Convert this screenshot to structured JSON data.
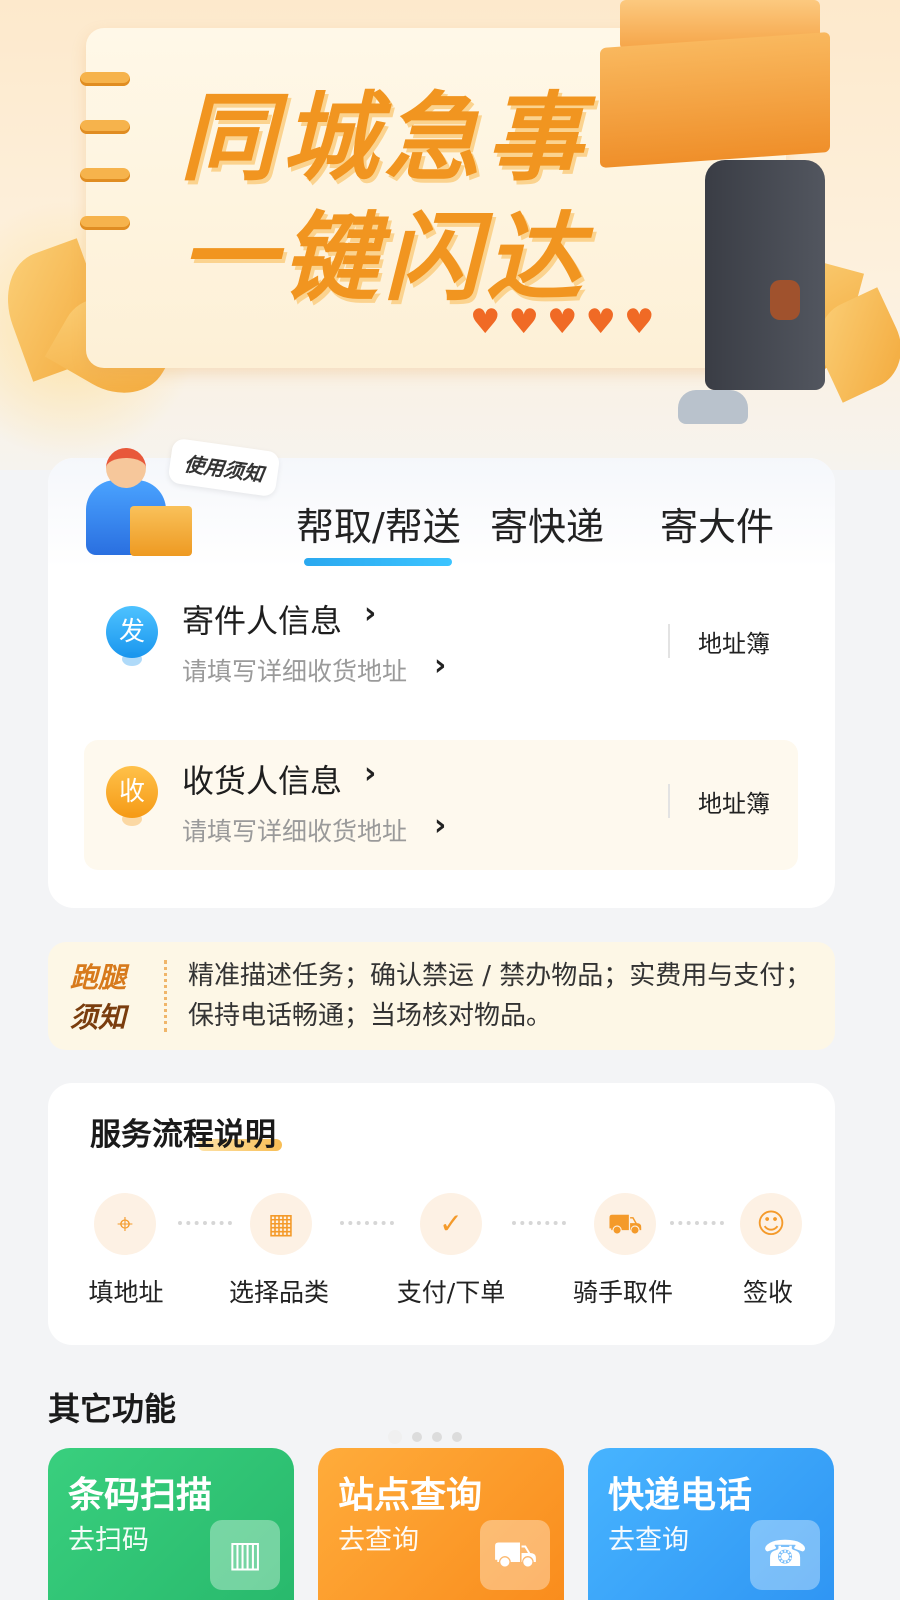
{
  "banner": {
    "headline_line1": "同城急事",
    "headline_line2": "一键闪达",
    "hearts": "♥"
  },
  "notice_tag": "使用须知",
  "tabs": [
    {
      "label": "帮取/帮送",
      "active": true
    },
    {
      "label": "寄快递",
      "active": false
    },
    {
      "label": "寄大件",
      "active": false
    }
  ],
  "sender": {
    "badge": "发",
    "title": "寄件人信息",
    "subtitle": "请填写详细收货地址",
    "address_book": "地址簿"
  },
  "receiver": {
    "badge": "收",
    "title": "收货人信息",
    "subtitle": "请填写详细收货地址",
    "address_book": "地址簿"
  },
  "errand_notice": {
    "title_line1": "跑腿",
    "title_line2": "须知",
    "text": "精准描述任务；确认禁运 / 禁办物品；实费用与支付；保持电话畅通；当场核对物品。"
  },
  "process": {
    "title": "服务流程说明",
    "steps": [
      {
        "label": "填地址",
        "icon": "location-pin-icon"
      },
      {
        "label": "选择品类",
        "icon": "category-grid-icon"
      },
      {
        "label": "支付/下单",
        "icon": "clipboard-check-icon"
      },
      {
        "label": "骑手取件",
        "icon": "scooter-icon"
      },
      {
        "label": "签收",
        "icon": "user-check-icon"
      }
    ]
  },
  "other": {
    "title": "其它功能",
    "features": [
      {
        "title": "条码扫描",
        "sub": "去扫码",
        "icon": "barcode-scanner-icon",
        "color": "#2fc474"
      },
      {
        "title": "站点查询",
        "sub": "去查询",
        "icon": "delivery-truck-icon",
        "color": "#fb9b29"
      },
      {
        "title": "快递电话",
        "sub": "去查询",
        "icon": "phone-icon",
        "color": "#3aa5f8"
      }
    ]
  },
  "colors": {
    "accent_blue": "#2aa8ef",
    "accent_orange": "#f19520",
    "background": "#f3f4f6"
  }
}
